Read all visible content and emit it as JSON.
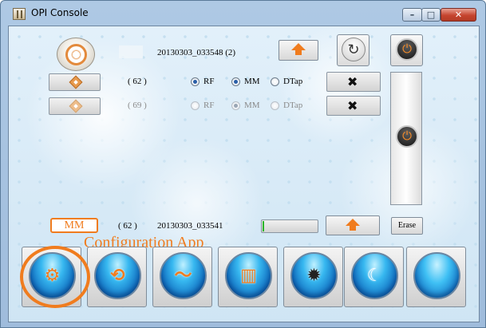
{
  "window": {
    "title": "OPI Console",
    "minimize": "–",
    "maximize": "□",
    "close": "✕"
  },
  "row1": {
    "session_file": "20130303_033548 (2)",
    "icons": {
      "logo": "target-logo-icon",
      "upload": "arrow-up-icon",
      "refresh": "refresh-icon",
      "power": "power-icon"
    },
    "refresh_glyph": "↻",
    "power_glyph": "⏻"
  },
  "channels": [
    {
      "count": "( 62 )",
      "options": [
        "RF",
        "MM",
        "DTap"
      ],
      "selected": "RF",
      "enabled": true
    },
    {
      "count": "( 69 )",
      "options": [
        "RF",
        "MM",
        "DTap"
      ],
      "selected": "MM",
      "enabled": false
    }
  ],
  "tool_glyph": "✖",
  "side_power_glyph": "⏻",
  "status": {
    "mode": "MM",
    "count": "( 62 )",
    "file": "20130303_033541",
    "progress": 0.03,
    "erase_label": "Erase"
  },
  "annotation": "Configuration App",
  "bottom_buttons": [
    {
      "name": "configuration-app-button",
      "icon": "gear-icon",
      "glyph": "⚙"
    },
    {
      "name": "sync-waveform-button",
      "icon": "sync-wave-icon",
      "glyph": "⟲"
    },
    {
      "name": "waveform-button",
      "icon": "waveform-circle-icon",
      "glyph": "〜"
    },
    {
      "name": "signal-panel-button",
      "icon": "signal-panel-icon",
      "glyph": "▥"
    },
    {
      "name": "brightness-button",
      "icon": "brightness-icon",
      "glyph": "✹"
    },
    {
      "name": "sleep-mode-button",
      "icon": "moon-icon",
      "glyph": "☾"
    },
    {
      "name": "blank-orb-button",
      "icon": "blank-orb-icon",
      "glyph": ""
    }
  ]
}
